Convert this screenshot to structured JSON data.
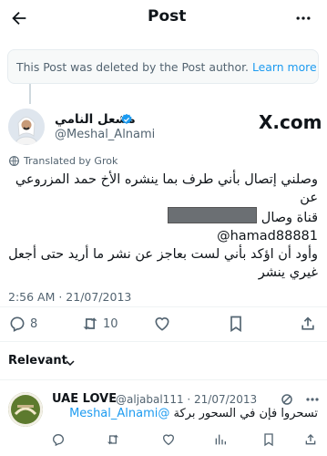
{
  "header": {
    "title": "Post"
  },
  "notice": {
    "text": "This Post was deleted by the Post author.",
    "link": "Learn more"
  },
  "tweet": {
    "author_name": "مشعل النامي",
    "handle": "@Meshal_Alnami",
    "source_logo": "X.com",
    "translated_label": "Translated by Grok",
    "line1": "وصلني إتصال بأني طرف بما ينشره الأخ حمد المزروعي عن",
    "line2": "قناة وصال",
    "line3": "hamad88881@",
    "line4": "وأود أن اؤكد بأني لست بعاجز عن نشر ما أريد حتى أجعل",
    "line5": "غيري ينشر",
    "timestamp": "2:56 AM · 21/07/2013",
    "replies": "8",
    "reposts": "10"
  },
  "replies_filter": {
    "label": "Relevant"
  },
  "reply": {
    "author_name": "UAE LOVE",
    "handle_date": "@aljabal111 · 21/07/2013",
    "mention": "@Meshal_Alnami",
    "text": "تسحروا فإن في السحور بركة"
  },
  "colors": {
    "accent": "#1d9bf0",
    "secondary_text": "#536471",
    "redaction": "#6b6f73"
  },
  "icons": [
    "back-arrow-icon",
    "more-dots-icon",
    "verified-badge-icon",
    "globe-icon",
    "reply-icon",
    "repost-icon",
    "like-icon",
    "bookmark-icon",
    "share-icon",
    "chevron-down-icon",
    "views-icon"
  ]
}
